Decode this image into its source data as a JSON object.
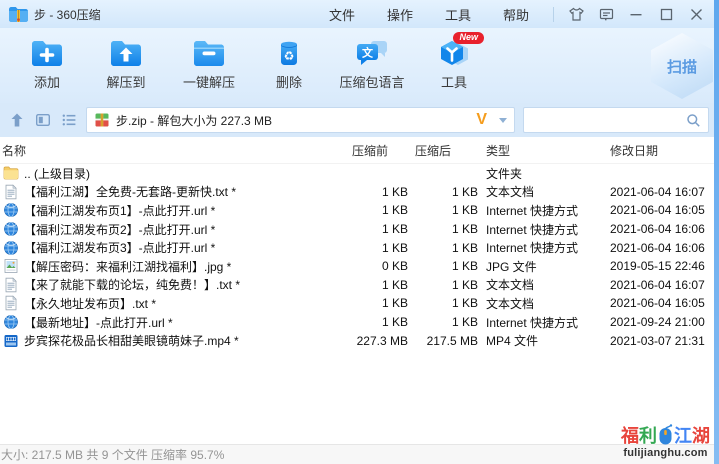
{
  "window": {
    "title": "步 - 360压缩",
    "menus": [
      "文件",
      "操作",
      "工具",
      "帮助"
    ],
    "control_icons": [
      "skin-icon",
      "feedback-icon",
      "minimize-icon",
      "maximize-icon",
      "close-icon"
    ]
  },
  "toolbar": {
    "buttons": [
      {
        "label": "添加",
        "icon": "add-folder-icon"
      },
      {
        "label": "解压到",
        "icon": "extract-to-icon"
      },
      {
        "label": "一键解压",
        "icon": "one-click-extract-icon"
      },
      {
        "label": "删除",
        "icon": "delete-icon"
      },
      {
        "label": "压缩包语言",
        "icon": "archive-language-icon"
      },
      {
        "label": "工具",
        "icon": "tools-icon",
        "badge": "New"
      }
    ],
    "scan_badge": "扫描"
  },
  "addressbar": {
    "nav_icons": [
      "up-icon",
      "preview-pane-icon",
      "list-view-icon"
    ],
    "archive_icon": "zip-file-icon",
    "address_value": "步.zip - 解包大小为 227.3 MB",
    "logo": "V",
    "search_placeholder": "",
    "search_icon": "search-icon"
  },
  "file_list": {
    "columns": [
      "名称",
      "压缩前",
      "压缩后",
      "类型",
      "修改日期"
    ],
    "rows": [
      {
        "icon": "folder-icon",
        "name": ".. (上级目录)",
        "before": "",
        "after": "",
        "type": "文件夹",
        "date": ""
      },
      {
        "icon": "text-file-icon",
        "name": "【福利江湖】全免费-无套路-更新快.txt *",
        "before": "1 KB",
        "after": "1 KB",
        "type": "文本文档",
        "date": "2021-06-04 16:07"
      },
      {
        "icon": "url-icon",
        "name": "【福利江湖发布页1】-点此打开.url *",
        "before": "1 KB",
        "after": "1 KB",
        "type": "Internet 快捷方式",
        "date": "2021-06-04 16:05"
      },
      {
        "icon": "url-icon",
        "name": "【福利江湖发布页2】-点此打开.url *",
        "before": "1 KB",
        "after": "1 KB",
        "type": "Internet 快捷方式",
        "date": "2021-06-04 16:06"
      },
      {
        "icon": "url-icon",
        "name": "【福利江湖发布页3】-点此打开.url *",
        "before": "1 KB",
        "after": "1 KB",
        "type": "Internet 快捷方式",
        "date": "2021-06-04 16:06"
      },
      {
        "icon": "image-file-icon",
        "name": "【解压密码：来福利江湖找福利】.jpg *",
        "before": "0 KB",
        "after": "1 KB",
        "type": "JPG 文件",
        "date": "2019-05-15 22:46"
      },
      {
        "icon": "text-file-icon",
        "name": "【来了就能下载的论坛，纯免费！】.txt *",
        "before": "1 KB",
        "after": "1 KB",
        "type": "文本文档",
        "date": "2021-06-04 16:07"
      },
      {
        "icon": "text-file-icon",
        "name": "【永久地址发布页】.txt *",
        "before": "1 KB",
        "after": "1 KB",
        "type": "文本文档",
        "date": "2021-06-04 16:05"
      },
      {
        "icon": "url-icon",
        "name": "【最新地址】-点此打开.url *",
        "before": "1 KB",
        "after": "1 KB",
        "type": "Internet 快捷方式",
        "date": "2021-09-24 21:00"
      },
      {
        "icon": "video-file-icon",
        "name": "步宾探花极品长相甜美眼镜萌妹子.mp4 *",
        "before": "227.3 MB",
        "after": "217.5 MB",
        "type": "MP4 文件",
        "date": "2021-03-07 21:31"
      }
    ]
  },
  "statusbar": {
    "text": "大小: 217.5 MB 共 9 个文件 压缩率 95.7%"
  },
  "watermark": {
    "chars": [
      {
        "text": "福",
        "color": "#e8453c"
      },
      {
        "text": "利",
        "color": "#34a853"
      },
      {
        "text": "江",
        "color": "#4285f4"
      },
      {
        "text": "湖",
        "color": "#e8453c"
      }
    ],
    "mouse_icon": "mouse-icon",
    "domain": "fulijianghu.com"
  },
  "colors": {
    "toolbar_icon_blue": "#1286ea",
    "badge_red": "#e8212d",
    "scan_text_blue": "#5b9be2",
    "logo_orange": "#f59d1e",
    "window_edge_blue": "#5ea7ee"
  }
}
